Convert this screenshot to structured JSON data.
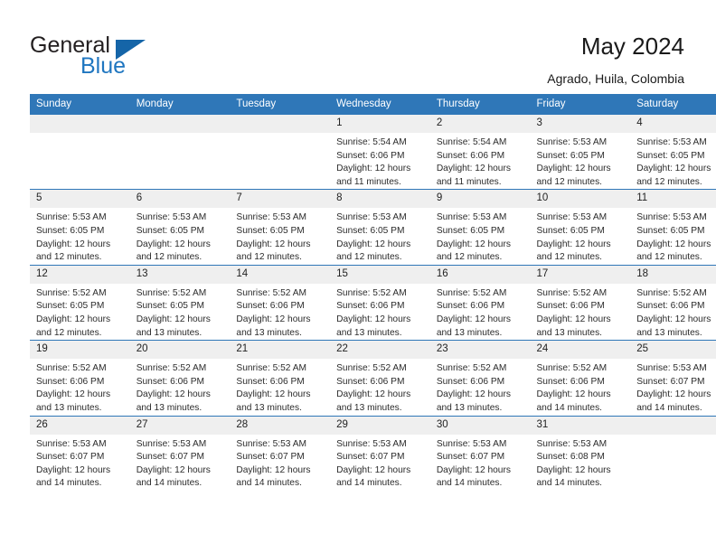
{
  "branding": {
    "name_part1": "General",
    "name_part2": "Blue",
    "triangle_color": "#1565a8",
    "blue_text_color": "#1f76c0"
  },
  "header": {
    "title": "May 2024",
    "location": "Agrado, Huila, Colombia",
    "header_bg_color": "#2f77b8",
    "header_text_color": "#ffffff"
  },
  "calendar": {
    "weekday_headers": [
      "Sunday",
      "Monday",
      "Tuesday",
      "Wednesday",
      "Thursday",
      "Friday",
      "Saturday"
    ],
    "labels": {
      "sunrise_prefix": "Sunrise:",
      "sunset_prefix": "Sunset:",
      "daylight_prefix": "Daylight:"
    },
    "weeks": [
      [
        {
          "day": "",
          "sunrise": "",
          "sunset": "",
          "daylight_line1": "",
          "daylight_line2": ""
        },
        {
          "day": "",
          "sunrise": "",
          "sunset": "",
          "daylight_line1": "",
          "daylight_line2": ""
        },
        {
          "day": "",
          "sunrise": "",
          "sunset": "",
          "daylight_line1": "",
          "daylight_line2": ""
        },
        {
          "day": "1",
          "sunrise": "Sunrise: 5:54 AM",
          "sunset": "Sunset: 6:06 PM",
          "daylight_line1": "Daylight: 12 hours",
          "daylight_line2": "and 11 minutes."
        },
        {
          "day": "2",
          "sunrise": "Sunrise: 5:54 AM",
          "sunset": "Sunset: 6:06 PM",
          "daylight_line1": "Daylight: 12 hours",
          "daylight_line2": "and 11 minutes."
        },
        {
          "day": "3",
          "sunrise": "Sunrise: 5:53 AM",
          "sunset": "Sunset: 6:05 PM",
          "daylight_line1": "Daylight: 12 hours",
          "daylight_line2": "and 12 minutes."
        },
        {
          "day": "4",
          "sunrise": "Sunrise: 5:53 AM",
          "sunset": "Sunset: 6:05 PM",
          "daylight_line1": "Daylight: 12 hours",
          "daylight_line2": "and 12 minutes."
        }
      ],
      [
        {
          "day": "5",
          "sunrise": "Sunrise: 5:53 AM",
          "sunset": "Sunset: 6:05 PM",
          "daylight_line1": "Daylight: 12 hours",
          "daylight_line2": "and 12 minutes."
        },
        {
          "day": "6",
          "sunrise": "Sunrise: 5:53 AM",
          "sunset": "Sunset: 6:05 PM",
          "daylight_line1": "Daylight: 12 hours",
          "daylight_line2": "and 12 minutes."
        },
        {
          "day": "7",
          "sunrise": "Sunrise: 5:53 AM",
          "sunset": "Sunset: 6:05 PM",
          "daylight_line1": "Daylight: 12 hours",
          "daylight_line2": "and 12 minutes."
        },
        {
          "day": "8",
          "sunrise": "Sunrise: 5:53 AM",
          "sunset": "Sunset: 6:05 PM",
          "daylight_line1": "Daylight: 12 hours",
          "daylight_line2": "and 12 minutes."
        },
        {
          "day": "9",
          "sunrise": "Sunrise: 5:53 AM",
          "sunset": "Sunset: 6:05 PM",
          "daylight_line1": "Daylight: 12 hours",
          "daylight_line2": "and 12 minutes."
        },
        {
          "day": "10",
          "sunrise": "Sunrise: 5:53 AM",
          "sunset": "Sunset: 6:05 PM",
          "daylight_line1": "Daylight: 12 hours",
          "daylight_line2": "and 12 minutes."
        },
        {
          "day": "11",
          "sunrise": "Sunrise: 5:53 AM",
          "sunset": "Sunset: 6:05 PM",
          "daylight_line1": "Daylight: 12 hours",
          "daylight_line2": "and 12 minutes."
        }
      ],
      [
        {
          "day": "12",
          "sunrise": "Sunrise: 5:52 AM",
          "sunset": "Sunset: 6:05 PM",
          "daylight_line1": "Daylight: 12 hours",
          "daylight_line2": "and 12 minutes."
        },
        {
          "day": "13",
          "sunrise": "Sunrise: 5:52 AM",
          "sunset": "Sunset: 6:05 PM",
          "daylight_line1": "Daylight: 12 hours",
          "daylight_line2": "and 13 minutes."
        },
        {
          "day": "14",
          "sunrise": "Sunrise: 5:52 AM",
          "sunset": "Sunset: 6:06 PM",
          "daylight_line1": "Daylight: 12 hours",
          "daylight_line2": "and 13 minutes."
        },
        {
          "day": "15",
          "sunrise": "Sunrise: 5:52 AM",
          "sunset": "Sunset: 6:06 PM",
          "daylight_line1": "Daylight: 12 hours",
          "daylight_line2": "and 13 minutes."
        },
        {
          "day": "16",
          "sunrise": "Sunrise: 5:52 AM",
          "sunset": "Sunset: 6:06 PM",
          "daylight_line1": "Daylight: 12 hours",
          "daylight_line2": "and 13 minutes."
        },
        {
          "day": "17",
          "sunrise": "Sunrise: 5:52 AM",
          "sunset": "Sunset: 6:06 PM",
          "daylight_line1": "Daylight: 12 hours",
          "daylight_line2": "and 13 minutes."
        },
        {
          "day": "18",
          "sunrise": "Sunrise: 5:52 AM",
          "sunset": "Sunset: 6:06 PM",
          "daylight_line1": "Daylight: 12 hours",
          "daylight_line2": "and 13 minutes."
        }
      ],
      [
        {
          "day": "19",
          "sunrise": "Sunrise: 5:52 AM",
          "sunset": "Sunset: 6:06 PM",
          "daylight_line1": "Daylight: 12 hours",
          "daylight_line2": "and 13 minutes."
        },
        {
          "day": "20",
          "sunrise": "Sunrise: 5:52 AM",
          "sunset": "Sunset: 6:06 PM",
          "daylight_line1": "Daylight: 12 hours",
          "daylight_line2": "and 13 minutes."
        },
        {
          "day": "21",
          "sunrise": "Sunrise: 5:52 AM",
          "sunset": "Sunset: 6:06 PM",
          "daylight_line1": "Daylight: 12 hours",
          "daylight_line2": "and 13 minutes."
        },
        {
          "day": "22",
          "sunrise": "Sunrise: 5:52 AM",
          "sunset": "Sunset: 6:06 PM",
          "daylight_line1": "Daylight: 12 hours",
          "daylight_line2": "and 13 minutes."
        },
        {
          "day": "23",
          "sunrise": "Sunrise: 5:52 AM",
          "sunset": "Sunset: 6:06 PM",
          "daylight_line1": "Daylight: 12 hours",
          "daylight_line2": "and 13 minutes."
        },
        {
          "day": "24",
          "sunrise": "Sunrise: 5:52 AM",
          "sunset": "Sunset: 6:06 PM",
          "daylight_line1": "Daylight: 12 hours",
          "daylight_line2": "and 14 minutes."
        },
        {
          "day": "25",
          "sunrise": "Sunrise: 5:53 AM",
          "sunset": "Sunset: 6:07 PM",
          "daylight_line1": "Daylight: 12 hours",
          "daylight_line2": "and 14 minutes."
        }
      ],
      [
        {
          "day": "26",
          "sunrise": "Sunrise: 5:53 AM",
          "sunset": "Sunset: 6:07 PM",
          "daylight_line1": "Daylight: 12 hours",
          "daylight_line2": "and 14 minutes."
        },
        {
          "day": "27",
          "sunrise": "Sunrise: 5:53 AM",
          "sunset": "Sunset: 6:07 PM",
          "daylight_line1": "Daylight: 12 hours",
          "daylight_line2": "and 14 minutes."
        },
        {
          "day": "28",
          "sunrise": "Sunrise: 5:53 AM",
          "sunset": "Sunset: 6:07 PM",
          "daylight_line1": "Daylight: 12 hours",
          "daylight_line2": "and 14 minutes."
        },
        {
          "day": "29",
          "sunrise": "Sunrise: 5:53 AM",
          "sunset": "Sunset: 6:07 PM",
          "daylight_line1": "Daylight: 12 hours",
          "daylight_line2": "and 14 minutes."
        },
        {
          "day": "30",
          "sunrise": "Sunrise: 5:53 AM",
          "sunset": "Sunset: 6:07 PM",
          "daylight_line1": "Daylight: 12 hours",
          "daylight_line2": "and 14 minutes."
        },
        {
          "day": "31",
          "sunrise": "Sunrise: 5:53 AM",
          "sunset": "Sunset: 6:08 PM",
          "daylight_line1": "Daylight: 12 hours",
          "daylight_line2": "and 14 minutes."
        },
        {
          "day": "",
          "sunrise": "",
          "sunset": "",
          "daylight_line1": "",
          "daylight_line2": ""
        }
      ]
    ]
  }
}
